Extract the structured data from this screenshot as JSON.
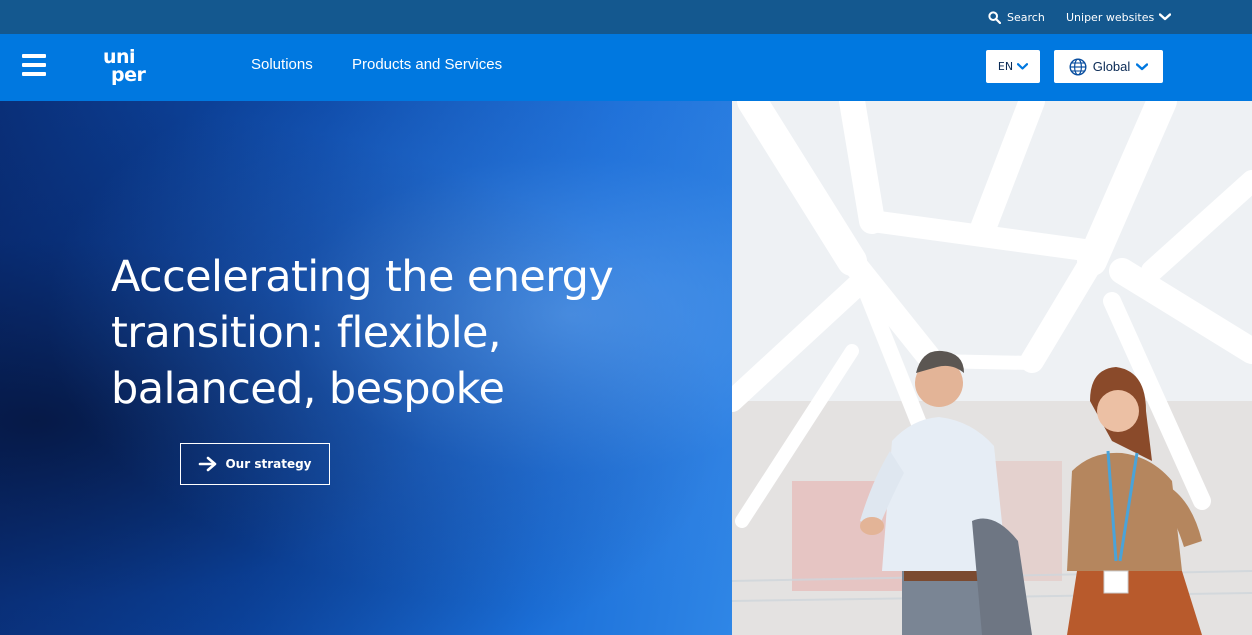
{
  "utility": {
    "search_label": "Search",
    "websites_label": "Uniper websites"
  },
  "nav": {
    "logo_line1": "uni",
    "logo_line2": "per",
    "items": [
      {
        "label": "Solutions"
      },
      {
        "label": "Products and Services"
      }
    ],
    "language": "EN",
    "region": "Global"
  },
  "hero": {
    "title_lines": [
      "Accelerating the energy",
      "transition: flexible,",
      "balanced, bespoke"
    ],
    "cta_label": "Our strategy"
  },
  "colors": {
    "utility_bar": "#14588f",
    "nav_bar": "#0078e0",
    "hero_blue": "#0d4aa8"
  },
  "icons": [
    "search-icon",
    "chevron-down-icon",
    "hamburger-icon",
    "globe-icon",
    "arrow-right-icon"
  ]
}
